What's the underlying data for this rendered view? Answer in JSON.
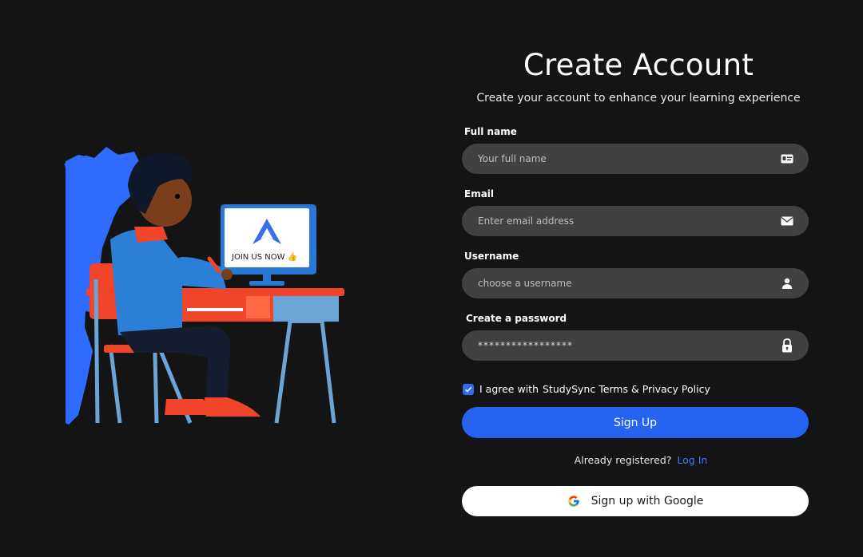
{
  "header": {
    "title": "Create Account",
    "subtitle": "Create your account to enhance your learning experience"
  },
  "illustration": {
    "monitor_text": "JOIN US NOW"
  },
  "form": {
    "fullname": {
      "label": "Full name",
      "placeholder": "Your full name",
      "icon": "id-card-icon"
    },
    "email": {
      "label": "Email",
      "placeholder": "Enter email address",
      "icon": "envelope-icon"
    },
    "username": {
      "label": "Username",
      "placeholder": "choose a username",
      "icon": "user-icon"
    },
    "password": {
      "label": "Create a password",
      "value": "*****************",
      "icon": "lock-icon"
    },
    "agree": {
      "checked": true,
      "text": "I agree with",
      "link": "StudySync Terms & Privacy Policy"
    },
    "signup_label": "Sign Up",
    "already_text": "Already registered?",
    "login_label": "Log In",
    "google_label": "Sign up with Google"
  },
  "colors": {
    "background": "#141414",
    "input_bg": "#414141",
    "primary": "#2563f0",
    "link": "#3d7bff"
  }
}
